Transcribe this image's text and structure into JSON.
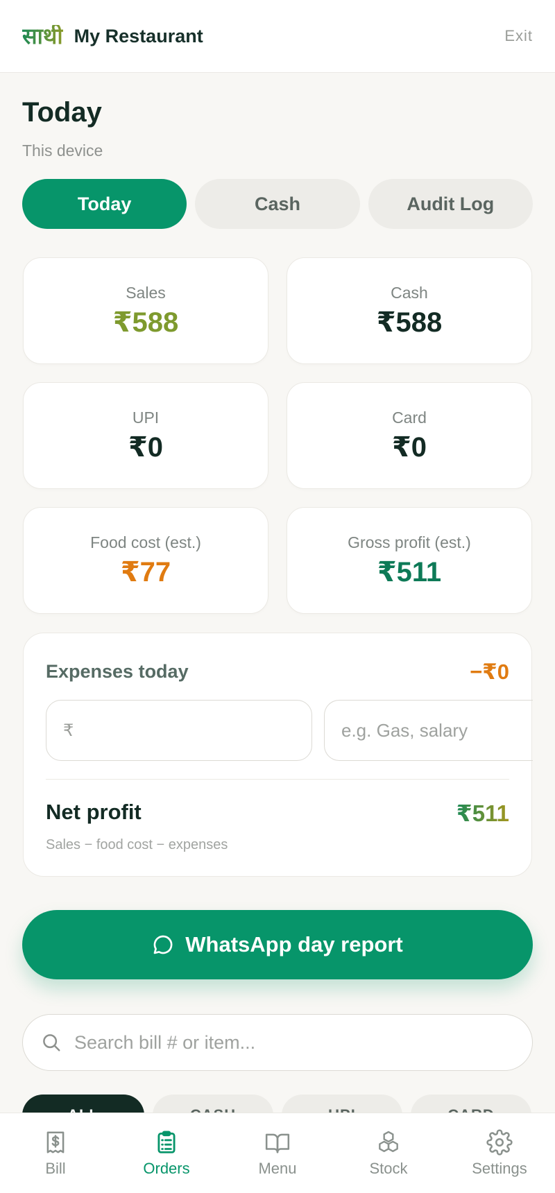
{
  "header": {
    "logo_text": "साथी",
    "app_title": "My Restaurant",
    "exit_label": "Exit"
  },
  "page": {
    "title": "Today",
    "subtitle": "This device"
  },
  "tabs": [
    {
      "label": "Today",
      "active": true
    },
    {
      "label": "Cash",
      "active": false
    },
    {
      "label": "Audit Log",
      "active": false
    }
  ],
  "stats": {
    "sales": {
      "label": "Sales",
      "value": "₹588"
    },
    "cash": {
      "label": "Cash",
      "value": "₹588"
    },
    "upi": {
      "label": "UPI",
      "value": "₹0"
    },
    "card": {
      "label": "Card",
      "value": "₹0"
    },
    "food_cost": {
      "label": "Food cost (est.)",
      "value": "₹77"
    },
    "gross_profit": {
      "label": "Gross profit (est.)",
      "value": "₹511"
    }
  },
  "expenses": {
    "label": "Expenses today",
    "amount": "−₹0",
    "amount_prefix": "₹",
    "amount_value": "",
    "note_placeholder": "e.g. Gas, salary",
    "note_value": ""
  },
  "net_profit": {
    "label": "Net profit",
    "value": "₹511",
    "subtitle": "Sales − food cost − expenses"
  },
  "whatsapp": {
    "label": "WhatsApp day report"
  },
  "search": {
    "placeholder": "Search bill # or item...",
    "value": ""
  },
  "filters": [
    {
      "label": "ALL",
      "active": true
    },
    {
      "label": "CASH",
      "active": false
    },
    {
      "label": "UPI",
      "active": false
    },
    {
      "label": "CARD",
      "active": false
    }
  ],
  "bottom_nav": [
    {
      "label": "Bill",
      "icon": "receipt-icon",
      "active": false
    },
    {
      "label": "Orders",
      "icon": "clipboard-icon",
      "active": true
    },
    {
      "label": "Menu",
      "icon": "book-icon",
      "active": false
    },
    {
      "label": "Stock",
      "icon": "boxes-icon",
      "active": false
    },
    {
      "label": "Settings",
      "icon": "gear-icon",
      "active": false
    }
  ],
  "colors": {
    "brand_green": "#07956a",
    "sales_olive": "#7e9a2e",
    "cost_orange": "#e07b11",
    "profit_green": "#0e7a57",
    "dark_text": "#132b24"
  }
}
